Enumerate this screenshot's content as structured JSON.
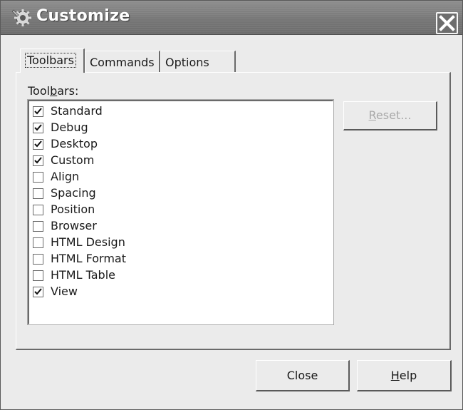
{
  "window": {
    "title": "Customize",
    "icon": "gear-icon",
    "close_icon": "close-icon"
  },
  "tabs": [
    {
      "label": "Toolbars",
      "active": true
    },
    {
      "label": "Commands",
      "active": false
    },
    {
      "label": "Options",
      "active": false
    }
  ],
  "toolbars_panel": {
    "label_pre": "Tool",
    "label_mnemonic": "b",
    "label_post": "ars:",
    "items": [
      {
        "label": "Standard",
        "checked": true
      },
      {
        "label": "Debug",
        "checked": true
      },
      {
        "label": "Desktop",
        "checked": true
      },
      {
        "label": "Custom",
        "checked": true
      },
      {
        "label": "Align",
        "checked": false
      },
      {
        "label": "Spacing",
        "checked": false
      },
      {
        "label": "Position",
        "checked": false
      },
      {
        "label": "Browser",
        "checked": false
      },
      {
        "label": "HTML Design",
        "checked": false
      },
      {
        "label": "HTML Format",
        "checked": false
      },
      {
        "label": "HTML Table",
        "checked": false
      },
      {
        "label": "View",
        "checked": true
      }
    ],
    "reset_mnemonic": "R",
    "reset_rest": "eset...",
    "reset_enabled": false
  },
  "footer": {
    "close_label": "Close",
    "help_mnemonic": "H",
    "help_rest": "elp"
  }
}
